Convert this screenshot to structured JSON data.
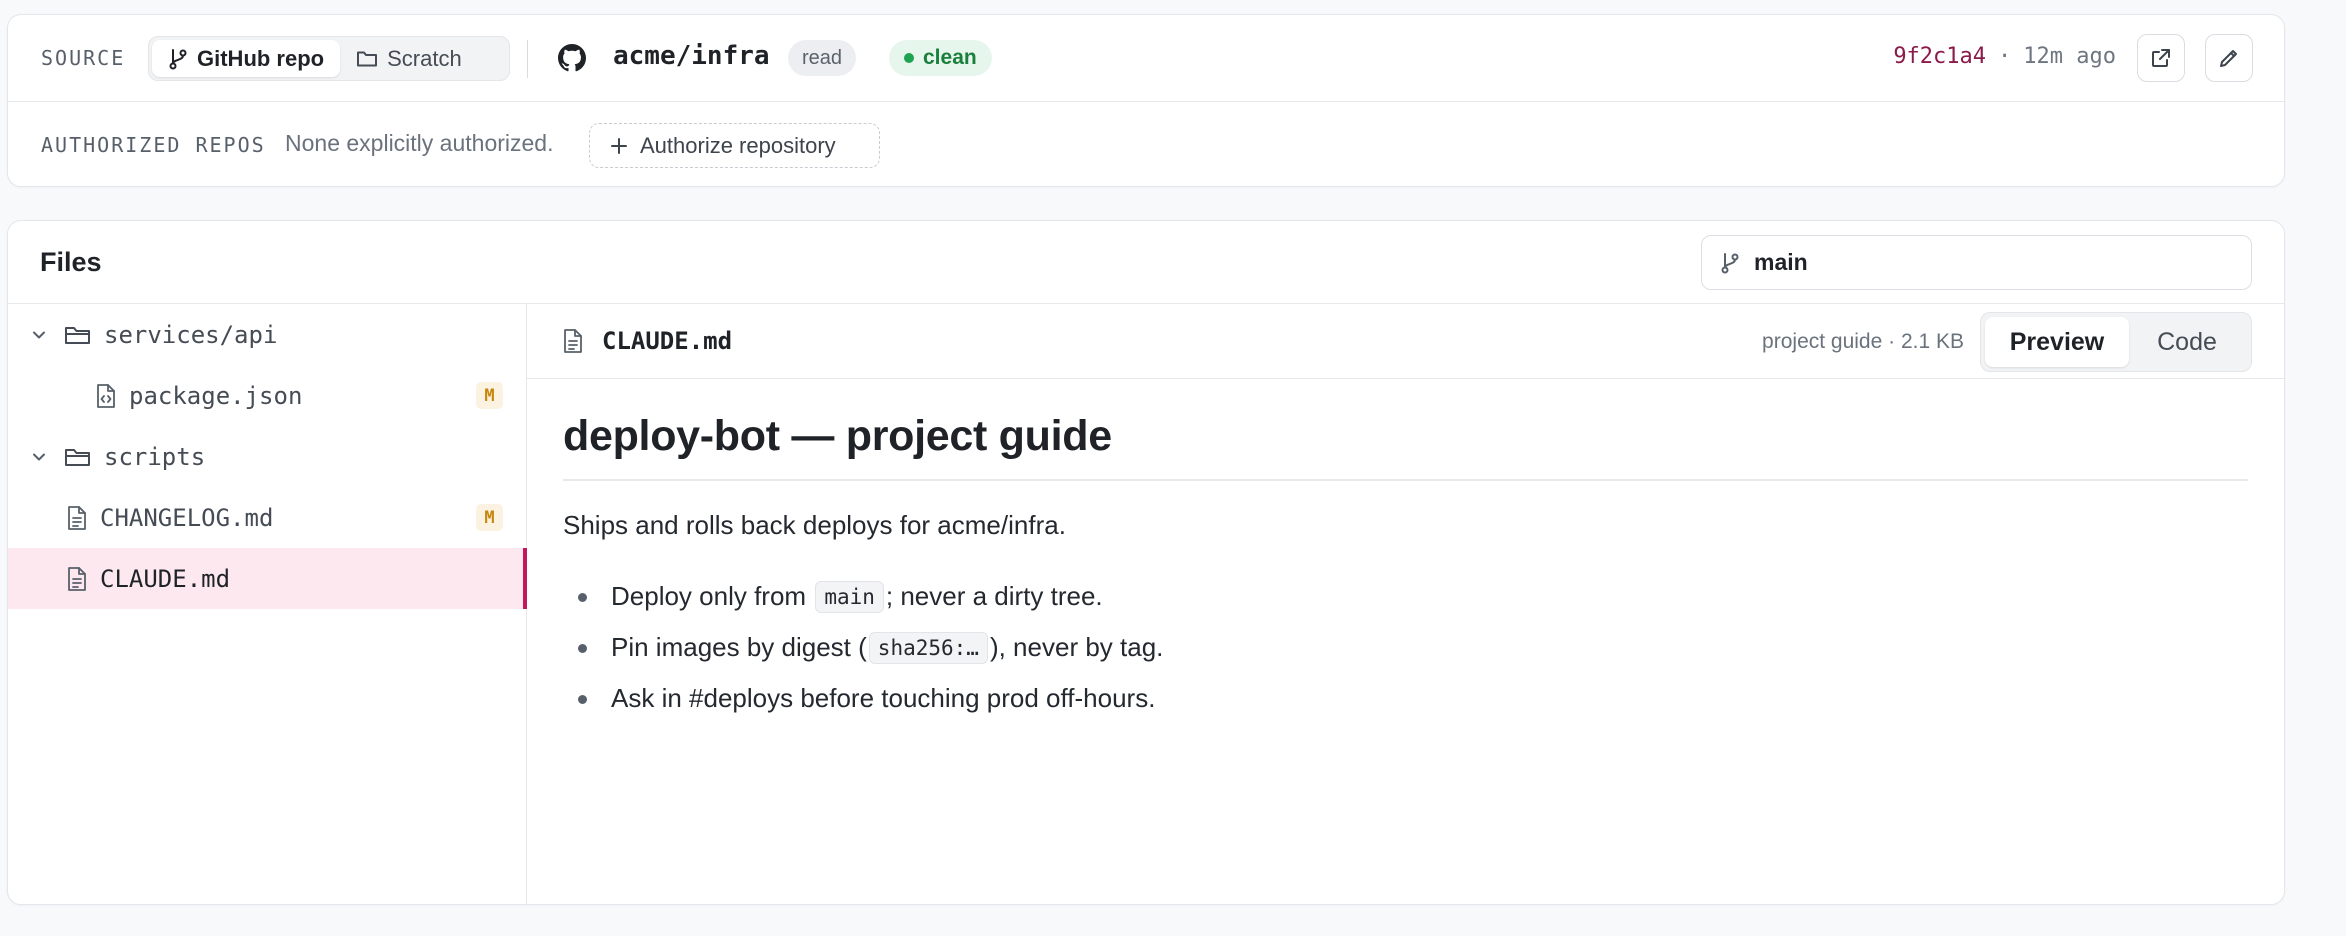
{
  "source": {
    "label": "SOURCE",
    "tabs": [
      {
        "label": "GitHub repo",
        "icon": "git-branch-icon",
        "active": true
      },
      {
        "label": "Scratch",
        "icon": "folder-icon",
        "active": false
      }
    ],
    "repo": "acme/infra",
    "permission_badge": "read",
    "status_badge": "clean",
    "commit_sha": "9f2c1a4",
    "separator": "·",
    "commit_time": "12m ago",
    "authorized_label": "AUTHORIZED REPOS",
    "authorized_value": "None explicitly authorized.",
    "authorize_button": "Authorize repository"
  },
  "files": {
    "title": "Files",
    "branch": "main",
    "tree": [
      {
        "name": "services/api",
        "type": "folder",
        "expanded": true,
        "modified": false
      },
      {
        "name": "package.json",
        "type": "file-code",
        "modified": true
      },
      {
        "name": "scripts",
        "type": "folder",
        "expanded": true,
        "modified": false
      },
      {
        "name": "CHANGELOG.md",
        "type": "file",
        "modified": true
      },
      {
        "name": "CLAUDE.md",
        "type": "file",
        "modified": false,
        "selected": true
      }
    ],
    "modified_badge": "M"
  },
  "viewer": {
    "file_name": "CLAUDE.md",
    "meta": "project guide · 2.1 KB",
    "preview_label": "Preview",
    "code_label": "Code",
    "doc": {
      "heading": "deploy-bot — project guide",
      "intro": "Ships and rolls back deploys for acme/infra.",
      "bullets": [
        {
          "before": "Deploy only from ",
          "code": "main",
          "after": "; never a dirty tree."
        },
        {
          "before": "Pin images by digest (",
          "code": "sha256:…",
          "after": "), never by tag."
        },
        {
          "before": "Ask in #deploys before touching prod off-hours.",
          "code": "",
          "after": ""
        }
      ]
    }
  },
  "colors": {
    "accent": "#c2185b",
    "commit_sha": "#8b1b4a",
    "clean_green": "#1a7f3c",
    "modified_amber": "#c7860c"
  }
}
